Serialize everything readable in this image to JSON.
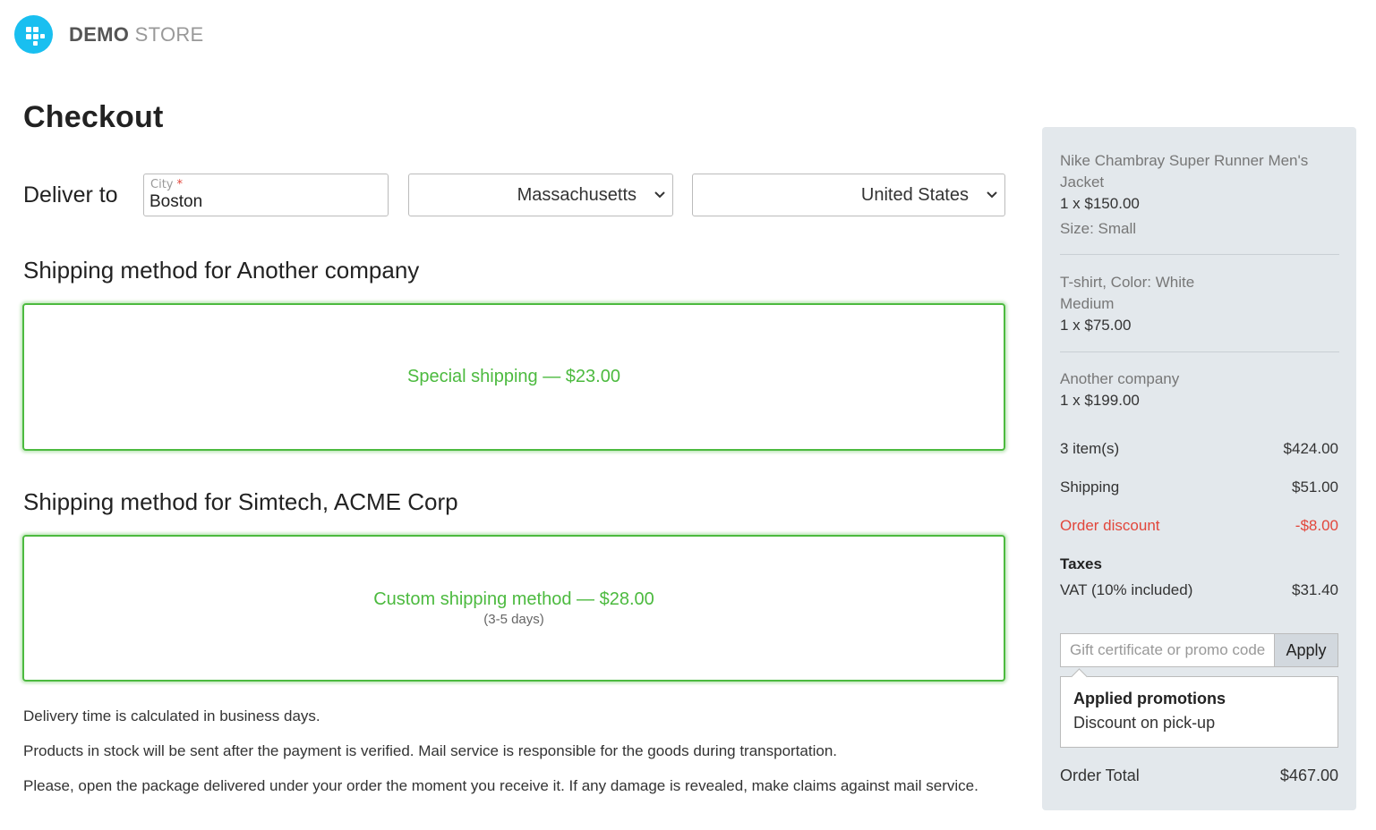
{
  "brand": {
    "bold": "DEMO",
    "light": "STORE",
    "accent": "#19bff0"
  },
  "page_title": "Checkout",
  "deliver": {
    "label": "Deliver to",
    "city_label": "City",
    "city_required": "*",
    "city_value": "Boston",
    "state": "Massachusetts",
    "country": "United States"
  },
  "shipping": [
    {
      "title": "Shipping method for Another company",
      "method": "Special shipping — $23.00",
      "note": ""
    },
    {
      "title": "Shipping method for Simtech, ACME Corp",
      "method": "Custom shipping method — $28.00",
      "note": "(3-5 days)"
    }
  ],
  "notes": [
    "Delivery time is calculated in business days.",
    "Products in stock will be sent after the payment is verified. Mail service is responsible for the goods during transportation.",
    "Please, open the package delivered under your order the moment you receive it. If any damage is revealed, make claims against mail service."
  ],
  "summary": {
    "products": [
      {
        "name": "Nike Chambray Super Runner Men's Jacket",
        "qty_price": "1 x $150.00",
        "option": "Size: Small"
      },
      {
        "name": "T-shirt, Color: White",
        "option": "Medium",
        "qty_price": "1 x $75.00"
      },
      {
        "name": "Another company",
        "qty_price": "1 x $199.00"
      }
    ],
    "items_label": "3 item(s)",
    "items_value": "$424.00",
    "shipping_label": "Shipping",
    "shipping_value": "$51.00",
    "discount_label": "Order discount",
    "discount_value": "-$8.00",
    "taxes_label": "Taxes",
    "vat_label": "VAT (10% included)",
    "vat_value": "$31.40",
    "promo_placeholder": "Gift certificate or promo code",
    "apply_label": "Apply",
    "applied_title": "Applied promotions",
    "applied_item": "Discount on pick-up",
    "total_label": "Order Total",
    "total_value": "$467.00"
  },
  "colors": {
    "success": "#4cba3f",
    "danger": "#e2463b",
    "panel": "#e3e8ec"
  }
}
